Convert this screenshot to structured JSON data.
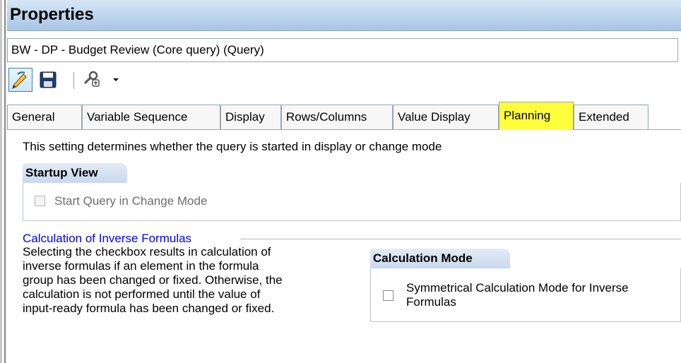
{
  "window": {
    "title": "Properties"
  },
  "query": {
    "name": "BW - DP - Budget Review (Core query) (Query)"
  },
  "toolbar": {
    "buttons": [
      {
        "icon": "pencil-edit-icon",
        "active": true
      },
      {
        "icon": "save-disk-icon",
        "active": false
      },
      {
        "icon": "tools-wrench-icon",
        "active": false
      }
    ],
    "dropdown_icon": "chevron-down-icon"
  },
  "tabs": [
    {
      "label": "General",
      "selected": false
    },
    {
      "label": "Variable Sequence",
      "selected": false
    },
    {
      "label": "Display",
      "selected": false
    },
    {
      "label": "Rows/Columns",
      "selected": false
    },
    {
      "label": "Value Display",
      "selected": false
    },
    {
      "label": "Planning",
      "selected": true
    },
    {
      "label": "Extended",
      "selected": false
    }
  ],
  "planning": {
    "intro": "This setting determines whether the query is started in display or change mode",
    "startup_view": {
      "header": "Startup View",
      "checkbox_label": "Start Query in Change Mode",
      "checked": false,
      "enabled": false
    },
    "inverse_formulas": {
      "legend": "Calculation of Inverse Formulas",
      "description_lines": [
        "Selecting the checkbox results in calculation of",
        "inverse formulas if an element in the formula",
        "group has been changed or fixed. Otherwise, the",
        "calculation is not performed until the value of",
        "input-ready formula has been changed or fixed."
      ]
    },
    "calculation_mode": {
      "header": "Calculation Mode",
      "checkbox_label_line1": "Symmetrical Calculation Mode for Inverse",
      "checkbox_label_line2": "Formulas",
      "checked": false
    }
  },
  "colors": {
    "tab_highlight": "#ffff3c",
    "legend_blue": "#0000ff",
    "titlebar": "#bcd3ec"
  }
}
